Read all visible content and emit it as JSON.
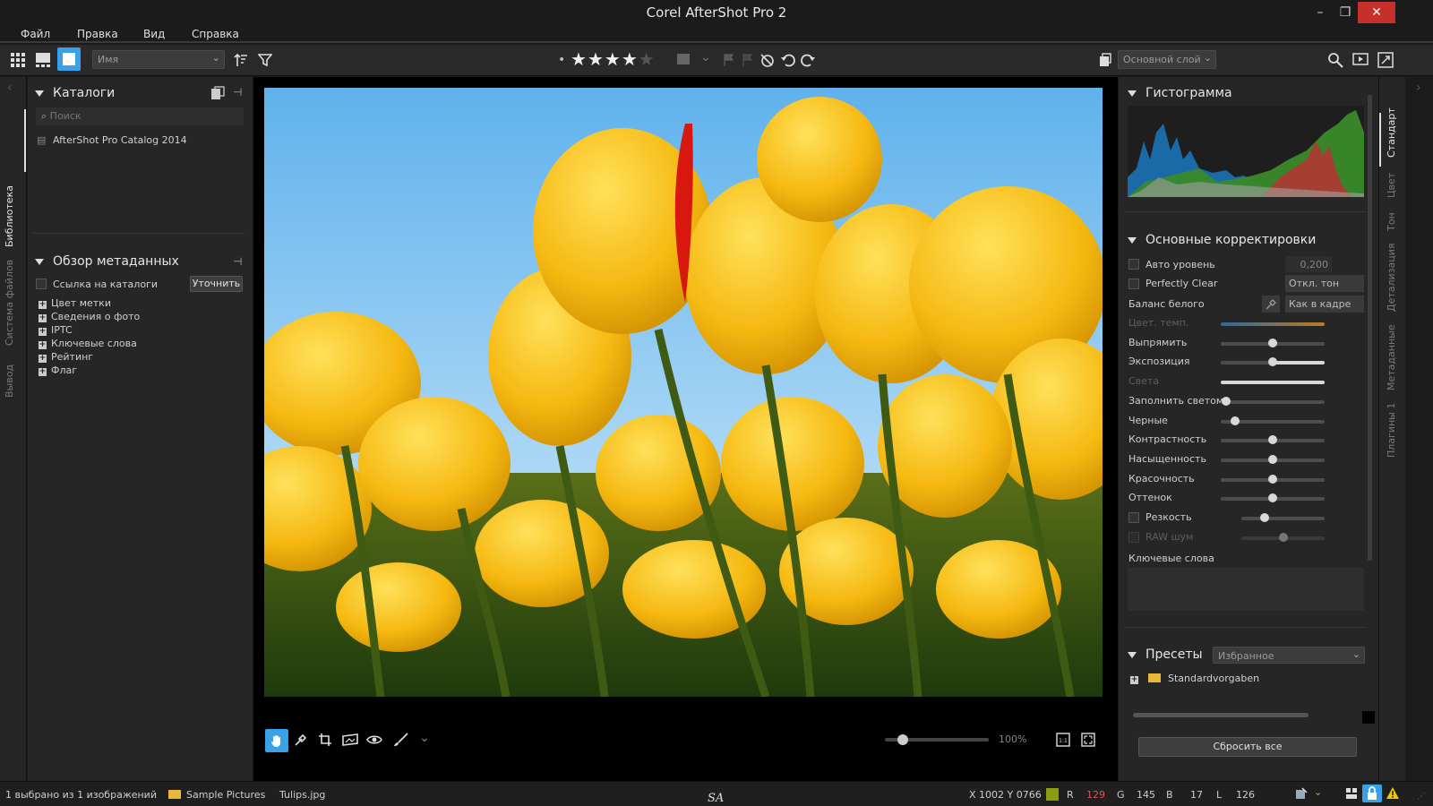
{
  "window": {
    "title": "Corel AfterShot Pro 2",
    "minimize": "–",
    "maximize": "❐",
    "close": "✕"
  },
  "menu": [
    "Файл",
    "Правка",
    "Вид",
    "Справка"
  ],
  "toolbar": {
    "sort_field": "Имя",
    "rating_stars": 4,
    "rating_max": 5,
    "layer_select": "Основной слой"
  },
  "left_strip": {
    "tabs": [
      "Библиотека",
      "Система файлов",
      "Вывод"
    ]
  },
  "catalogs": {
    "title": "Каталоги",
    "search_placeholder": "Поиск",
    "items": [
      "AfterShot Pro Catalog 2014"
    ]
  },
  "metadata": {
    "title": "Обзор метаданных",
    "link_label": "Ссылка на каталоги",
    "refine_button": "Уточнить",
    "items": [
      "Цвет метки",
      "Сведения о фото",
      "IPTC",
      "Ключевые слова",
      "Рейтинг",
      "Флаг"
    ]
  },
  "histogram": {
    "title": "Гистограмма"
  },
  "adjustments": {
    "title": "Основные корректировки",
    "auto_level": "Авто уровень",
    "auto_level_value": "0,200",
    "perfectly_clear": "Perfectly Clear",
    "perfectly_clear_mode": "Откл. тон",
    "white_balance": "Баланс белого",
    "white_balance_mode": "Как в кадре",
    "sliders": [
      {
        "label": "Цвет. темп.",
        "value": 0.42,
        "dim": true
      },
      {
        "label": "Выпрямить",
        "value": 0.5,
        "dim": false
      },
      {
        "label": "Экспозиция",
        "value": 0.5,
        "dim": false
      },
      {
        "label": "Света",
        "value": 0.5,
        "dim": true
      },
      {
        "label": "Заполнить светом",
        "value": 0.05,
        "dim": false
      },
      {
        "label": "Черные",
        "value": 0.14,
        "dim": false
      },
      {
        "label": "Контрастность",
        "value": 0.5,
        "dim": false
      },
      {
        "label": "Насыщенность",
        "value": 0.5,
        "dim": false
      },
      {
        "label": "Красочность",
        "value": 0.5,
        "dim": false
      },
      {
        "label": "Оттенок",
        "value": 0.5,
        "dim": false
      }
    ],
    "sharpness": "Резкость",
    "sharpness_value": 0.28,
    "raw_noise": "RAW шум",
    "raw_noise_value": 0.5,
    "keywords_label": "Ключевые слова"
  },
  "presets": {
    "title": "Пресеты",
    "filter": "Избранное",
    "items": [
      "Standardvorgaben"
    ]
  },
  "reset_button": "Сбросить все",
  "right_strip": {
    "tabs": [
      "Стандарт",
      "Цвет",
      "Тон",
      "Детализация",
      "Метаданные",
      "Плагины 1"
    ]
  },
  "viewer": {
    "zoom": "100%",
    "zoom_level": 0.17
  },
  "status": {
    "selection": "1 выбрано из 1 изображений",
    "folder": "Sample Pictures",
    "file": "Tulips.jpg",
    "center_mark": "SA",
    "coords": "X 1002  Y 0766",
    "r_label": "R",
    "r": "129",
    "g_label": "G",
    "g": "145",
    "b_label": "B",
    "b": "17",
    "l_label": "L",
    "l": "126"
  },
  "colors": {
    "accent": "#3aa0e8",
    "close": "#c7302a",
    "swatch": "#8b9b14"
  }
}
